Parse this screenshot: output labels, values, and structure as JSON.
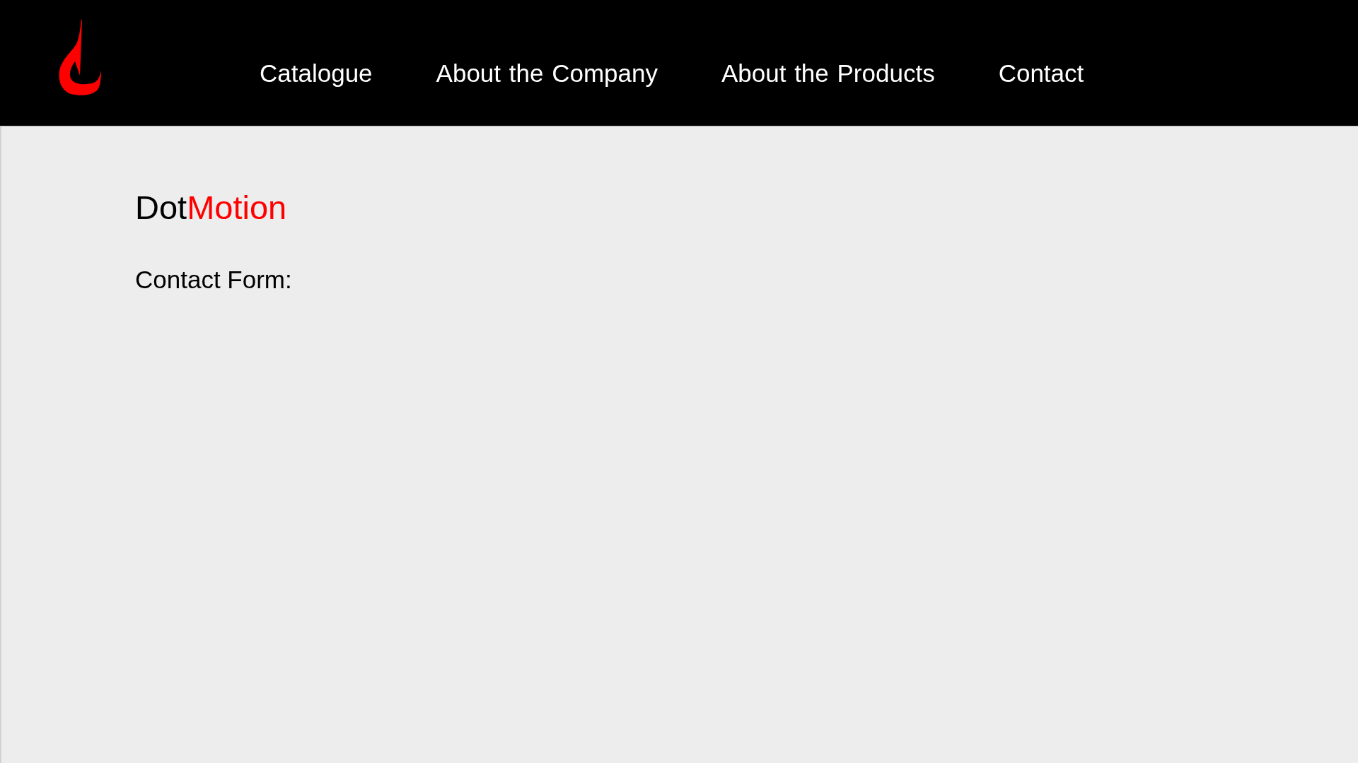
{
  "header": {
    "nav": [
      {
        "label": "Catalogue"
      },
      {
        "label": "About the Company"
      },
      {
        "label": "About the Products"
      },
      {
        "label": "Contact"
      }
    ]
  },
  "content": {
    "title": {
      "parts": [
        {
          "text": "Dot",
          "accent": false
        },
        {
          "text": "Motion",
          "accent": true
        }
      ]
    },
    "heading": "Contact Form:"
  }
}
